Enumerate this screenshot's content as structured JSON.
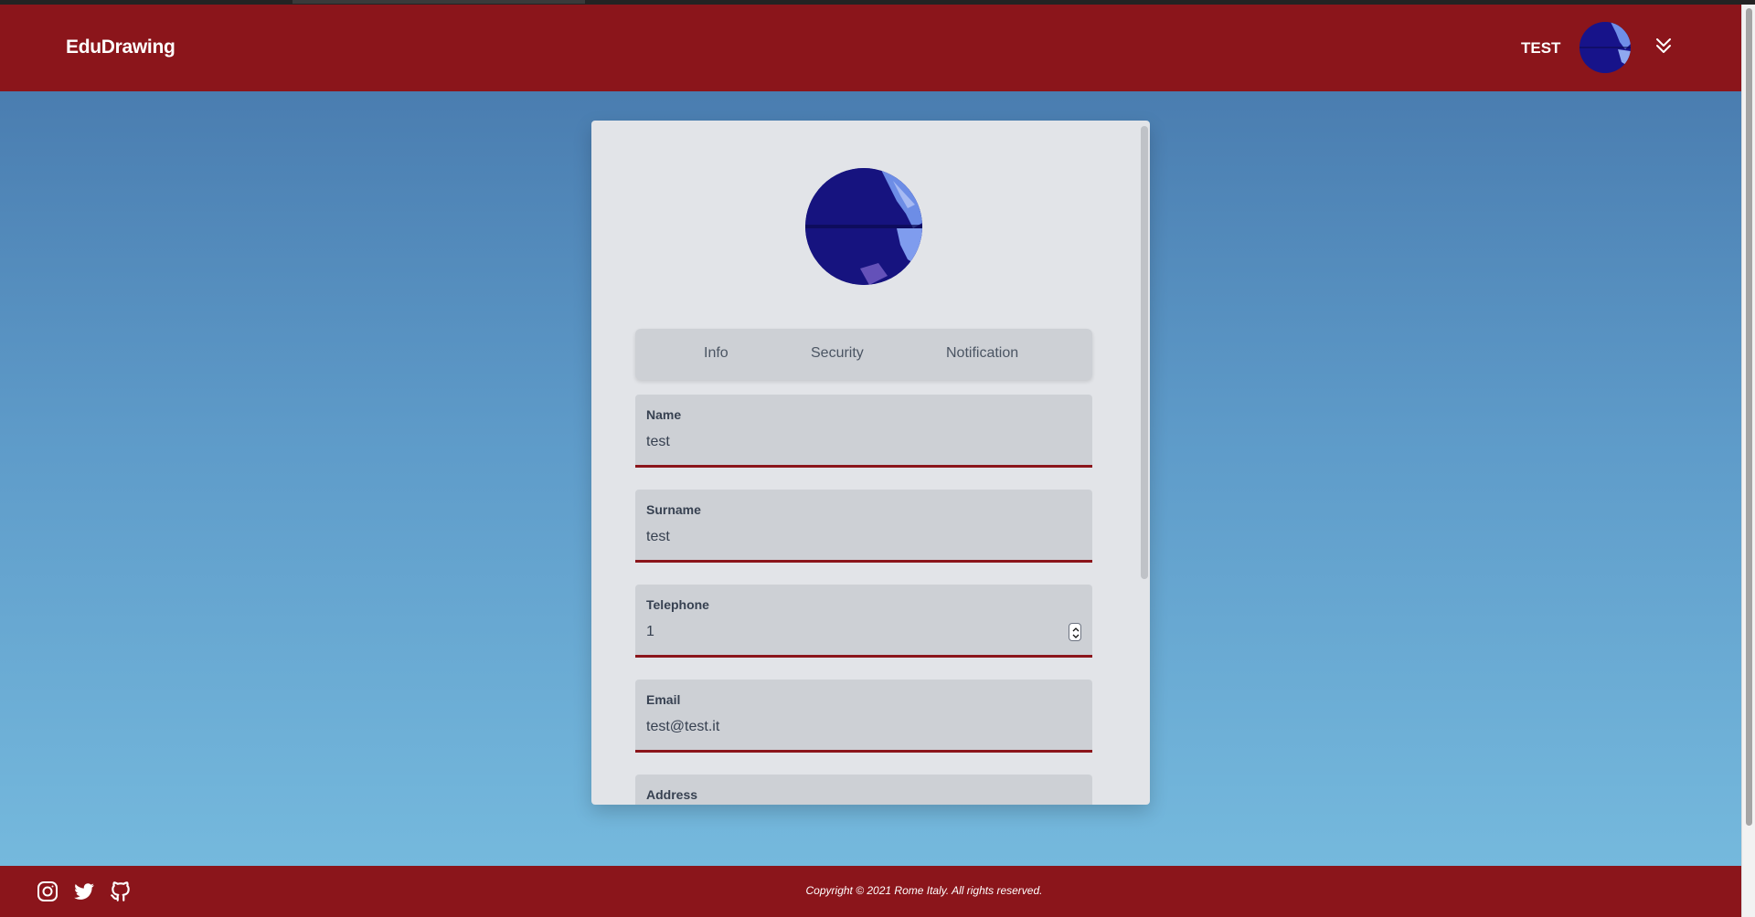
{
  "header": {
    "brand": "EduDrawing",
    "username": "TEST",
    "menu_icon": "chevron-double-down-icon"
  },
  "profile": {
    "tabs": [
      {
        "label": "Info"
      },
      {
        "label": "Security"
      },
      {
        "label": "Notification"
      }
    ],
    "fields": [
      {
        "label": "Name",
        "value": "test"
      },
      {
        "label": "Surname",
        "value": "test"
      },
      {
        "label": "Telephone",
        "value": "1"
      },
      {
        "label": "Email",
        "value": "test@test.it"
      },
      {
        "label": "Address",
        "value": ""
      }
    ]
  },
  "footer": {
    "icons": [
      "instagram-icon",
      "twitter-icon",
      "github-icon"
    ],
    "copyright": "Copyright © 2021 Rome Italy. All rights reserved."
  },
  "colors": {
    "brand": "#8b151b",
    "background_top": "#4a7db0",
    "background_bottom": "#75b9dd",
    "card": "#e2e4e8",
    "field": "#cdd0d5"
  }
}
